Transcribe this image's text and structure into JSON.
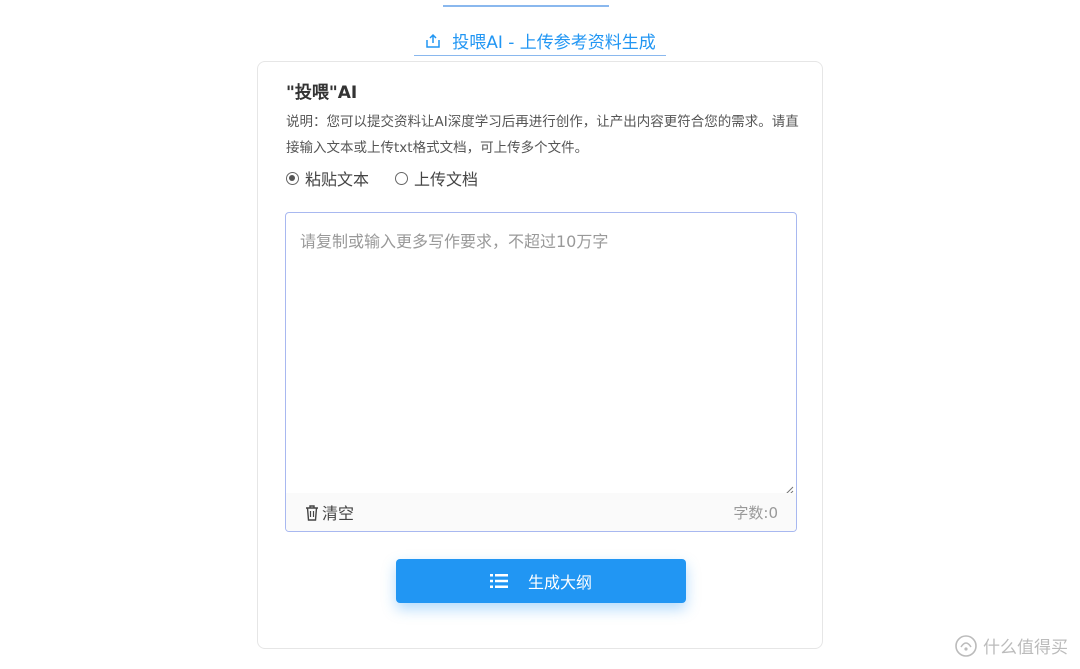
{
  "tab": {
    "label": "投喂AI - 上传参考资料生成",
    "icon": "upload-icon",
    "color": "#2196f3"
  },
  "card": {
    "title": "\"投喂\"AI",
    "description": "说明：您可以提交资料让AI深度学习后再进行创作，让产出内容更符合您的需求。请直接输入文本或上传txt格式文档，可上传多个文件。"
  },
  "input_mode": {
    "options": [
      {
        "label": "粘贴文本",
        "checked": true
      },
      {
        "label": "上传文档",
        "checked": false
      }
    ]
  },
  "editor": {
    "value": "",
    "placeholder": "请复制或输入更多写作要求，不超过10万字",
    "clear_label": "清空",
    "count_label": "字数:0",
    "border_color": "#a8b8f0"
  },
  "generate_button": {
    "label": "生成大纲",
    "icon": "list-icon",
    "color": "#2196f3"
  },
  "watermark": {
    "text": "什么值得买",
    "icon": "smzdm-logo"
  }
}
